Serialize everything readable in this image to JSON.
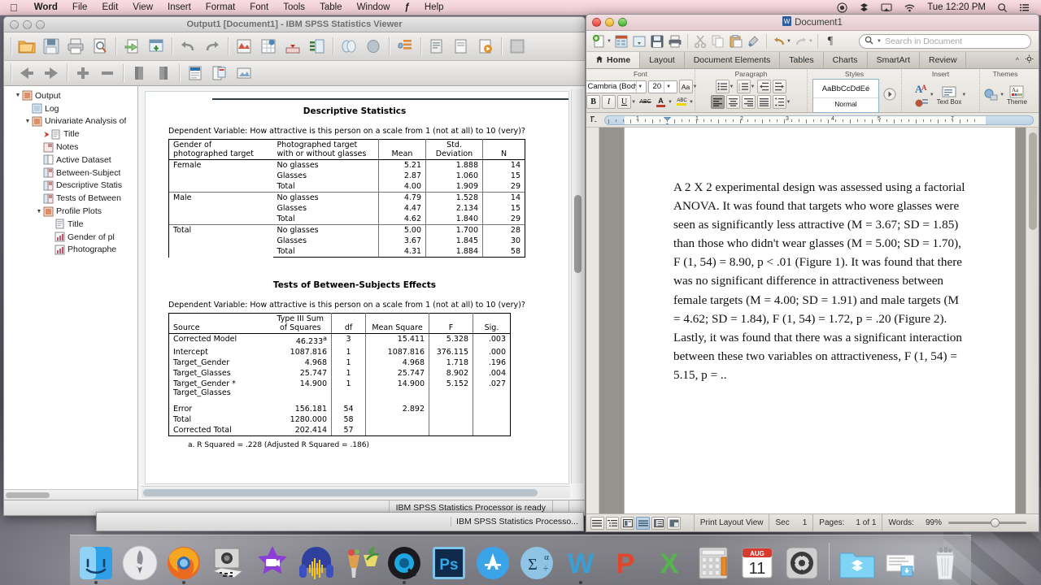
{
  "menubar": {
    "apple_icon": "apple-logo-icon",
    "items": [
      {
        "label": "Word",
        "bold": true
      },
      {
        "label": "File",
        "bold": false
      },
      {
        "label": "Edit",
        "bold": false
      },
      {
        "label": "View",
        "bold": false
      },
      {
        "label": "Insert",
        "bold": false
      },
      {
        "label": "Format",
        "bold": false
      },
      {
        "label": "Font",
        "bold": false
      },
      {
        "label": "Tools",
        "bold": false
      },
      {
        "label": "Table",
        "bold": false
      },
      {
        "label": "Window",
        "bold": false
      },
      {
        "label": "ƒ",
        "bold": false
      },
      {
        "label": "Help",
        "bold": false
      }
    ],
    "status_icons": [
      "record-icon",
      "dropbox-icon",
      "airplay-icon",
      "wifi-icon"
    ],
    "clock": "Tue 12:20 PM",
    "right_icons": [
      "spotlight-search-icon",
      "notification-center-icon"
    ]
  },
  "spss": {
    "title": "Output1 [Document1] - IBM SPSS Statistics Viewer",
    "window_buttons": [
      "close-button",
      "minimize-button",
      "zoom-button"
    ],
    "toolbar_row1": [
      "open-file-icon",
      "save-icon",
      "print-icon",
      "print-preview-icon",
      "export-icon",
      "go-to-data-icon",
      "undo-icon",
      "redo-icon",
      "goto-case-icon",
      "variables-icon",
      "insert-cases-icon",
      "split-file-icon",
      "select-cases-icon",
      "weight-cases-icon",
      "value-labels-icon",
      "use-sets-icon",
      "show-all-variables-icon",
      "run-icon",
      "dialog-recall-icon"
    ],
    "toolbar_row2": [
      "back-icon",
      "forward-icon",
      "promote-icon",
      "demote-icon",
      "collapse-icon",
      "expand-icon",
      "show-hide-icon",
      "insert-title-icon",
      "insert-text-icon",
      "insert-object-icon"
    ],
    "tree": [
      {
        "label": "Output",
        "indent": 0,
        "twisty": "▼",
        "icon": "output-icon",
        "mark": ""
      },
      {
        "label": "Log",
        "indent": 1,
        "twisty": "",
        "icon": "log-icon",
        "mark": ""
      },
      {
        "label": "Univariate Analysis of",
        "indent": 1,
        "twisty": "▼",
        "icon": "analysis-icon",
        "mark": ""
      },
      {
        "label": "Title",
        "indent": 2,
        "twisty": "",
        "icon": "title-icon",
        "mark": "⮞"
      },
      {
        "label": "Notes",
        "indent": 2,
        "twisty": "",
        "icon": "notes-icon",
        "mark": ""
      },
      {
        "label": "Active Dataset",
        "indent": 2,
        "twisty": "",
        "icon": "dataset-icon",
        "mark": ""
      },
      {
        "label": "Between-Subject",
        "indent": 2,
        "twisty": "",
        "icon": "table-icon",
        "mark": ""
      },
      {
        "label": "Descriptive Statis",
        "indent": 2,
        "twisty": "",
        "icon": "table-icon",
        "mark": ""
      },
      {
        "label": "Tests of Between",
        "indent": 2,
        "twisty": "",
        "icon": "table-icon",
        "mark": ""
      },
      {
        "label": "Profile Plots",
        "indent": 2,
        "twisty": "▼",
        "icon": "analysis-icon",
        "mark": ""
      },
      {
        "label": "Title",
        "indent": 3,
        "twisty": "",
        "icon": "title-icon",
        "mark": ""
      },
      {
        "label": "Gender of pl",
        "indent": 3,
        "twisty": "",
        "icon": "chart-icon",
        "mark": ""
      },
      {
        "label": "Photographe",
        "indent": 3,
        "twisty": "",
        "icon": "chart-icon",
        "mark": ""
      }
    ],
    "status": {
      "message": "IBM SPSS Statistics Processor is ready"
    },
    "background_window_status": "IBM SPSS Statistics Processo..."
  },
  "descriptive": {
    "title": "Descriptive Statistics",
    "dependent_variable": "Dependent Variable: How attractive is this person on a scale from 1 (not at all) to 10 (very)?",
    "headers": [
      "Gender of photographed target",
      "Photographed target with or without glasses",
      "Mean",
      "Std. Deviation",
      "N"
    ],
    "header_lines": [
      [
        "Gender of",
        "photographed target"
      ],
      [
        "Photographed target",
        "with or without glasses"
      ],
      [
        "Mean"
      ],
      [
        "Std.",
        "Deviation"
      ],
      [
        "N"
      ]
    ],
    "groups": [
      {
        "label": "Female",
        "rows": [
          {
            "level": "No glasses",
            "mean": "5.21",
            "sd": "1.888",
            "n": "14"
          },
          {
            "level": "Glasses",
            "mean": "2.87",
            "sd": "1.060",
            "n": "15"
          },
          {
            "level": "Total",
            "mean": "4.00",
            "sd": "1.909",
            "n": "29"
          }
        ]
      },
      {
        "label": "Male",
        "rows": [
          {
            "level": "No glasses",
            "mean": "4.79",
            "sd": "1.528",
            "n": "14"
          },
          {
            "level": "Glasses",
            "mean": "4.47",
            "sd": "2.134",
            "n": "15"
          },
          {
            "level": "Total",
            "mean": "4.62",
            "sd": "1.840",
            "n": "29"
          }
        ]
      },
      {
        "label": "Total",
        "rows": [
          {
            "level": "No glasses",
            "mean": "5.00",
            "sd": "1.700",
            "n": "28"
          },
          {
            "level": "Glasses",
            "mean": "3.67",
            "sd": "1.845",
            "n": "30"
          },
          {
            "level": "Total",
            "mean": "4.31",
            "sd": "1.884",
            "n": "58"
          }
        ]
      }
    ]
  },
  "anova": {
    "title": "Tests of Between-Subjects Effects",
    "dependent_variable": "Dependent Variable: How attractive is this person on a scale from 1 (not at all) to 10 (very)?",
    "header_lines": [
      [
        "Source"
      ],
      [
        "Type III Sum",
        "of Squares"
      ],
      [
        "df"
      ],
      [
        "Mean Square"
      ],
      [
        "F"
      ],
      [
        "Sig."
      ]
    ],
    "rows": [
      {
        "source": [
          "Corrected Model"
        ],
        "ss": "46.233",
        "ss_sup": "a",
        "df": "3",
        "ms": "15.411",
        "f": "5.328",
        "sig": ".003"
      },
      {
        "source": [
          "Intercept"
        ],
        "ss": "1087.816",
        "ss_sup": "",
        "df": "1",
        "ms": "1087.816",
        "f": "376.115",
        "sig": ".000"
      },
      {
        "source": [
          "Target_Gender"
        ],
        "ss": "4.968",
        "ss_sup": "",
        "df": "1",
        "ms": "4.968",
        "f": "1.718",
        "sig": ".196"
      },
      {
        "source": [
          "Target_Glasses"
        ],
        "ss": "25.747",
        "ss_sup": "",
        "df": "1",
        "ms": "25.747",
        "f": "8.902",
        "sig": ".004"
      },
      {
        "source": [
          "Target_Gender *",
          "Target_Glasses"
        ],
        "ss": "14.900",
        "ss_sup": "",
        "df": "1",
        "ms": "14.900",
        "f": "5.152",
        "sig": ".027"
      },
      {
        "source": [
          "Error"
        ],
        "ss": "156.181",
        "ss_sup": "",
        "df": "54",
        "ms": "2.892",
        "f": "",
        "sig": "",
        "gap": true
      },
      {
        "source": [
          "Total"
        ],
        "ss": "1280.000",
        "ss_sup": "",
        "df": "58",
        "ms": "",
        "f": "",
        "sig": ""
      },
      {
        "source": [
          "Corrected Total"
        ],
        "ss": "202.414",
        "ss_sup": "",
        "df": "57",
        "ms": "",
        "f": "",
        "sig": ""
      }
    ],
    "footnote": "a. R Squared = .228 (Adjusted R Squared = .186)"
  },
  "word": {
    "title": "Document1",
    "title_icon": "word-document-icon",
    "window_buttons": [
      "close-button",
      "minimize-button",
      "zoom-button"
    ],
    "std_toolbar": [
      "new-document-icon",
      "new-from-template-icon",
      "open-icon",
      "save-icon",
      "print-icon",
      "cut-icon",
      "copy-icon",
      "paste-icon",
      "format-painter-icon",
      "undo-icon",
      "redo-icon",
      "show-marks-icon"
    ],
    "search": {
      "icon": "magnifier-icon",
      "placeholder": "Search in Document",
      "value": ""
    },
    "tabs": [
      {
        "label": "Home",
        "active": true,
        "icon": "home-icon"
      },
      {
        "label": "Layout",
        "active": false,
        "icon": ""
      },
      {
        "label": "Document Elements",
        "active": false,
        "icon": ""
      },
      {
        "label": "Tables",
        "active": false,
        "icon": ""
      },
      {
        "label": "Charts",
        "active": false,
        "icon": ""
      },
      {
        "label": "SmartArt",
        "active": false,
        "icon": ""
      },
      {
        "label": "Review",
        "active": false,
        "icon": ""
      }
    ],
    "tab_right_icons": [
      "collapse-ribbon-icon",
      "ribbon-options-gear-icon"
    ],
    "ribbon": {
      "groups": [
        {
          "label": "Font"
        },
        {
          "label": "Paragraph"
        },
        {
          "label": "Styles"
        },
        {
          "label": "Insert"
        },
        {
          "label": "Themes"
        }
      ],
      "font_name": "Cambria (Body)",
      "font_size": "20",
      "font_buttons": [
        "bold-button",
        "italic-button",
        "underline-button",
        "strikethrough-button",
        "font-color-button",
        "highlight-button",
        "change-case-button"
      ],
      "paragraph_buttons": [
        "bulleted-list-button",
        "numbered-list-button",
        "decrease-indent-button",
        "increase-indent-button",
        "align-left-button",
        "align-center-button",
        "align-right-button",
        "justify-button",
        "line-spacing-button"
      ],
      "style_preview": "AaBbCcDdEé",
      "style_name": "Normal",
      "insert_buttons": [
        "text-box-button",
        "shapes-button",
        "picture-button"
      ],
      "insert_label": "Text Box",
      "themes_label": "Theme",
      "bold_label": "B",
      "italic_label": "I",
      "underline_label": "U",
      "strike_label": "ABC",
      "fontcolor_label": "A",
      "highlight_label": "ABC",
      "casechange_label": "Aa",
      "themes_tile": "Aa"
    },
    "ruler": {
      "numbers": [
        "1",
        "1",
        "2",
        "3",
        "4",
        "5",
        "7"
      ]
    },
    "document_text": "A 2 X 2 experimental design was assessed using a factorial ANOVA.  It was found that targets who wore glasses were seen as significantly less attractive (M = 3.67; SD = 1.85) than those who didn't wear glasses (M = 5.00; SD = 1.70), F (1, 54) = 8.90, p < .01 (Figure 1).  It was found that there was no significant difference in attractiveness between female targets (M = 4.00; SD = 1.91) and male targets (M = 4.62; SD = 1.84), F (1, 54) = 1.72, p = .20 (Figure 2).  Lastly, it was found that there was a significant interaction between these two variables on attractiveness, F (1, 54) = 5.15, p = ..",
    "status": {
      "view_buttons": [
        "draft-view-button",
        "outline-view-button",
        "publishing-layout-button",
        "print-layout-button",
        "notebook-layout-button",
        "full-screen-button"
      ],
      "view_name": "Print Layout View",
      "sec_label": "Sec",
      "sec_value": "1",
      "pages_label": "Pages:",
      "pages_value": "1 of 1",
      "words_label": "Words:",
      "zoom": "99%"
    }
  },
  "dock": {
    "items": [
      {
        "name": "finder",
        "running": true
      },
      {
        "name": "launchpad",
        "running": false
      },
      {
        "name": "firefox",
        "running": true
      },
      {
        "name": "image-capture",
        "running": false
      },
      {
        "name": "imovie",
        "running": false
      },
      {
        "name": "audacity",
        "running": false
      },
      {
        "name": "fruit-smoothie",
        "running": false
      },
      {
        "name": "quicktime",
        "running": true
      },
      {
        "name": "photoshop",
        "running": false
      },
      {
        "name": "app-store",
        "running": false
      },
      {
        "name": "spss",
        "running": false
      },
      {
        "name": "microsoft-word",
        "running": true
      },
      {
        "name": "microsoft-powerpoint",
        "running": false
      },
      {
        "name": "microsoft-excel",
        "running": false
      },
      {
        "name": "calculator",
        "running": false
      },
      {
        "name": "calendar",
        "running": false
      },
      {
        "name": "system-preferences",
        "running": false
      },
      {
        "name": "dropbox-folder",
        "running": false
      },
      {
        "name": "downloads-stack",
        "running": false
      },
      {
        "name": "trash",
        "running": false
      }
    ],
    "calendar_month": "AUG",
    "calendar_day": "11"
  }
}
